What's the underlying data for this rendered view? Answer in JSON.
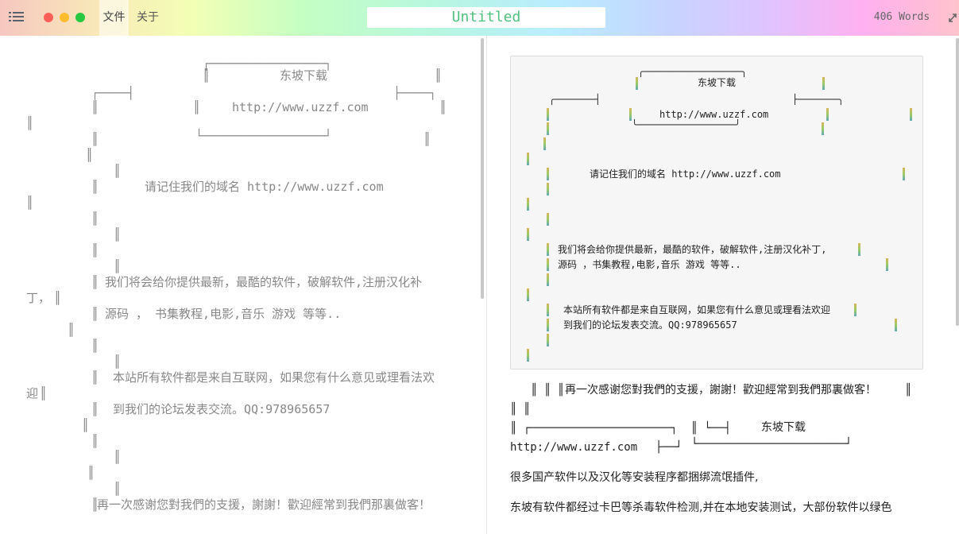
{
  "titlebar": {
    "menu_file": "文件",
    "menu_about": "关于",
    "title": "Untitled",
    "word_count": "406 Words"
  },
  "editor": {
    "lines": [
      "东坡下载",
      "http://www.uzzf.com",
      "请记住我们的域名 http://www.uzzf.com",
      "我们将会给你提供最新，最酷的软件，破解软件,注册汉化补",
      "丁，",
      "源码 ， 书集教程,电影,音乐 游戏 等等..",
      "本站所有软件都是来自互联网，如果您有什么意见或理看法欢",
      "迎",
      "到我们的论坛发表交流。QQ:978965657",
      "再一次感谢您對我們的支援，謝謝！歡迎經常到我們那裏做客！"
    ]
  },
  "preview": {
    "code": {
      "site_name": "东坡下载",
      "url": "http://www.uzzf.com",
      "remember": "请记住我们的域名 http://www.uzzf.com",
      "provide_1": "我们将会给你提供最新，最酷的软件，破解软件,注册汉化补丁,",
      "provide_2": "源码 ，书集教程,电影,音乐 游戏 等等..",
      "source_1": "本站所有软件都是来自互联网，如果您有什么意见或理看法欢迎",
      "source_2": "到我们的论坛发表交流。QQ:978965657"
    },
    "thanks": "再一次感谢您對我們的支援，謝謝！歡迎經常到我們那裏做客！",
    "site_name": "东坡下载",
    "url": "http://www.uzzf.com",
    "para_1": "很多国产软件以及汉化等安装程序都捆绑流氓插件,",
    "para_2": "东坡有软件都经过卡巴等杀毒软件检测,并在本地安装测试，大部份软件以绿色"
  },
  "colors": {
    "title_text": "#52c07f",
    "editor_text": "#888888",
    "preview_text": "#222222"
  }
}
